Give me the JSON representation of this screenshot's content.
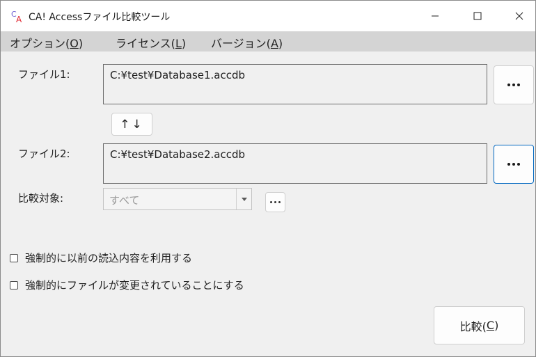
{
  "window": {
    "title": "CA! Accessファイル比較ツール",
    "controls": [
      "minimize",
      "maximize",
      "close"
    ]
  },
  "menu": {
    "items": [
      {
        "label": "オプション(",
        "key": "O",
        "end": ")"
      },
      {
        "label": "ライセンス(",
        "key": "L",
        "end": ")"
      },
      {
        "label": "バージョン(",
        "key": "A",
        "end": ")"
      }
    ]
  },
  "file1": {
    "label": "ファイル1:",
    "value": "C:¥test¥Database1.accdb"
  },
  "swap": {
    "label": "↑↓"
  },
  "file2": {
    "label": "ファイル2:",
    "value": "C:¥test¥Database2.accdb"
  },
  "target": {
    "label": "比較対象:",
    "value": "すべて"
  },
  "options": [
    {
      "label": "強制的に以前の読込内容を利用する",
      "checked": false
    },
    {
      "label": "強制的にファイルが変更されていることにする",
      "checked": false
    }
  ],
  "compare": {
    "label": "比較(",
    "key": "C",
    "end": ")"
  },
  "colors": {
    "titlebar": "#ffffff",
    "menubar": "#d4d4d4",
    "body": "#f0f0f0",
    "focus": "#0067c0",
    "icon_c": "#6b5fd3",
    "icon_a": "#e0242f"
  }
}
